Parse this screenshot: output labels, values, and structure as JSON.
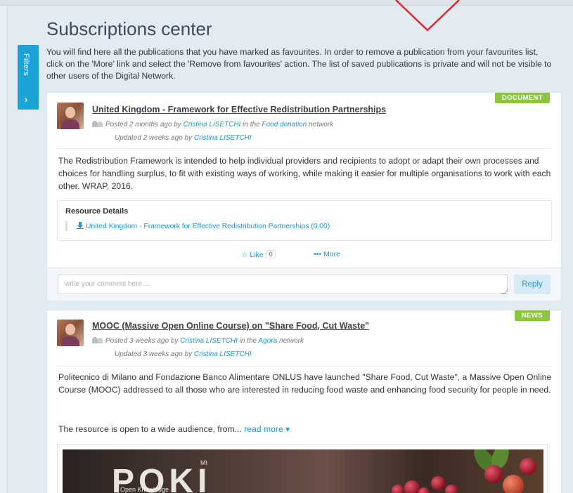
{
  "page": {
    "title": "Subscriptions center",
    "intro": "You will find here all the publications that you have marked as favourites. In order to remove a publication from your favourites list, click on the 'More' link and select the 'Remove from favourites' action. The list of saved publications is private and will not be visible to other users of the Digital Network."
  },
  "filters": {
    "label": "Filters",
    "arrow": "›"
  },
  "posts": [
    {
      "badge": "DOCUMENT",
      "badge_color": "#8cc63e",
      "title": "United Kingdom - Framework for Effective Redistribution Partnerships",
      "posted_prefix": "Posted 2 months ago by",
      "author": "Cristina LISETCHI",
      "in_the": "in the",
      "network": "Food donation",
      "network_suffix": "network",
      "updated_prefix": "Updated 2 weeks ago by",
      "updated_author": "Cristina LISETCHI",
      "body": "The Redistribution Framework is intended to help individual providers and recipients to adopt or adapt their own processes and choices for handling surplus, to fit with existing ways of working, while making it easier for multiple organisations to work with each other. WRAP, 2016.",
      "resources_heading": "Resource Details",
      "resource_link": "United Kingdom - Framework for Effective Redistribution Partnerships (0.00)",
      "like_label": "☆ Like",
      "like_count": "0",
      "more_label": "••• More",
      "comment_placeholder": "write your comment here ...",
      "reply_label": "Reply"
    },
    {
      "badge": "NEWS",
      "badge_color": "#8cc63e",
      "title": "MOOC (Massive Open Online Course) on \"Share Food, Cut Waste\"",
      "posted_prefix": "Posted 3 weeks ago by",
      "author": "Cristina LISETCHI",
      "in_the": "in the",
      "network": "Agora",
      "network_suffix": "network",
      "updated_prefix": "Updated 3 weeks ago by",
      "updated_author": "Cristina LISETCHI",
      "body": "Politecnico di Milano and Fondazione Banco Alimentare ONLUS have launched \"Share Food, Cut Waste\", a Massive Open Online Course (MOOC) addressed to all those who are interested in reducing food waste and enhancing food security for people in need.",
      "body2": "The resource is open to a wide audience, from...",
      "read_more": "read more ▾",
      "image_logo": "POKI",
      "image_logo_sup": "MI",
      "image_tagline": "Open Knowledge"
    }
  ],
  "colors": {
    "accent": "#1a9ad0",
    "filters_tab": "#1ba3d6",
    "badge": "#8cc63e",
    "chevron": "#e0262e"
  }
}
